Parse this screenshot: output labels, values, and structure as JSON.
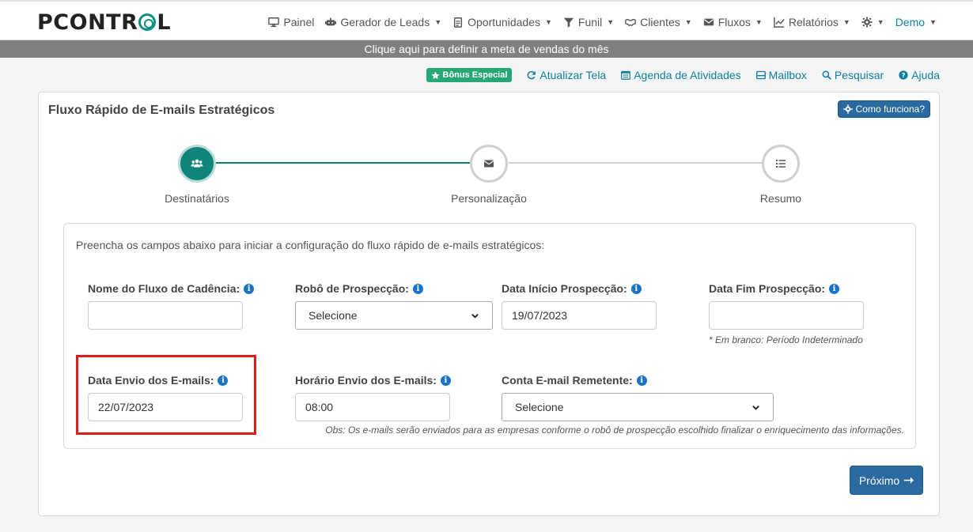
{
  "brand": {
    "logo_text_1": "P",
    "logo_text_2": "CONTR",
    "logo_text_3": "L"
  },
  "nav": {
    "items": [
      {
        "label": "Painel"
      },
      {
        "label": "Gerador de Leads"
      },
      {
        "label": "Oportunidades"
      },
      {
        "label": "Funil"
      },
      {
        "label": "Clientes"
      },
      {
        "label": "Fluxos"
      },
      {
        "label": "Relatórios"
      },
      {
        "label": "Demo"
      }
    ]
  },
  "goal_bar": {
    "text": "Clique aqui para definir a meta de vendas do mês"
  },
  "toolbar": {
    "bonus": "Bônus Especial",
    "refresh": "Atualizar Tela",
    "agenda": "Agenda de Atividades",
    "mailbox": "Mailbox",
    "search": "Pesquisar",
    "help": "Ajuda"
  },
  "card": {
    "title": "Fluxo Rápido de E-mails Estratégicos",
    "how_button": "Como funciona?"
  },
  "steps": [
    {
      "label": "Destinatários",
      "state": "active"
    },
    {
      "label": "Personalização",
      "state": "inactive"
    },
    {
      "label": "Resumo",
      "state": "inactive"
    }
  ],
  "form": {
    "intro": "Preencha os campos abaixo para iniciar a configuração do fluxo rápido de e-mails estratégicos:",
    "flow_name": {
      "label": "Nome do Fluxo de Cadência:",
      "value": ""
    },
    "robot": {
      "label": "Robô de Prospecção:",
      "value": "Selecione"
    },
    "start_date": {
      "label": "Data Início Prospecção:",
      "value": "19/07/2023"
    },
    "end_date": {
      "label": "Data Fim Prospecção:",
      "value": "",
      "hint": "* Em branco: Período Indeterminado"
    },
    "send_date": {
      "label": "Data Envio dos E-mails:",
      "value": "22/07/2023"
    },
    "send_time": {
      "label": "Horário Envio dos E-mails:",
      "value": "08:00"
    },
    "sender": {
      "label": "Conta E-mail Remetente:",
      "value": "Selecione"
    },
    "obs": "Obs: Os e-mails serão enviados para as empresas conforme o robô de prospecção escolhido finalizar o enriquecimento das informações."
  },
  "next_button": "Próximo",
  "colors": {
    "primary": "#0f8478",
    "button": "#2a6aa1",
    "link": "#0f7f9f",
    "highlight": "#e01b1b"
  }
}
